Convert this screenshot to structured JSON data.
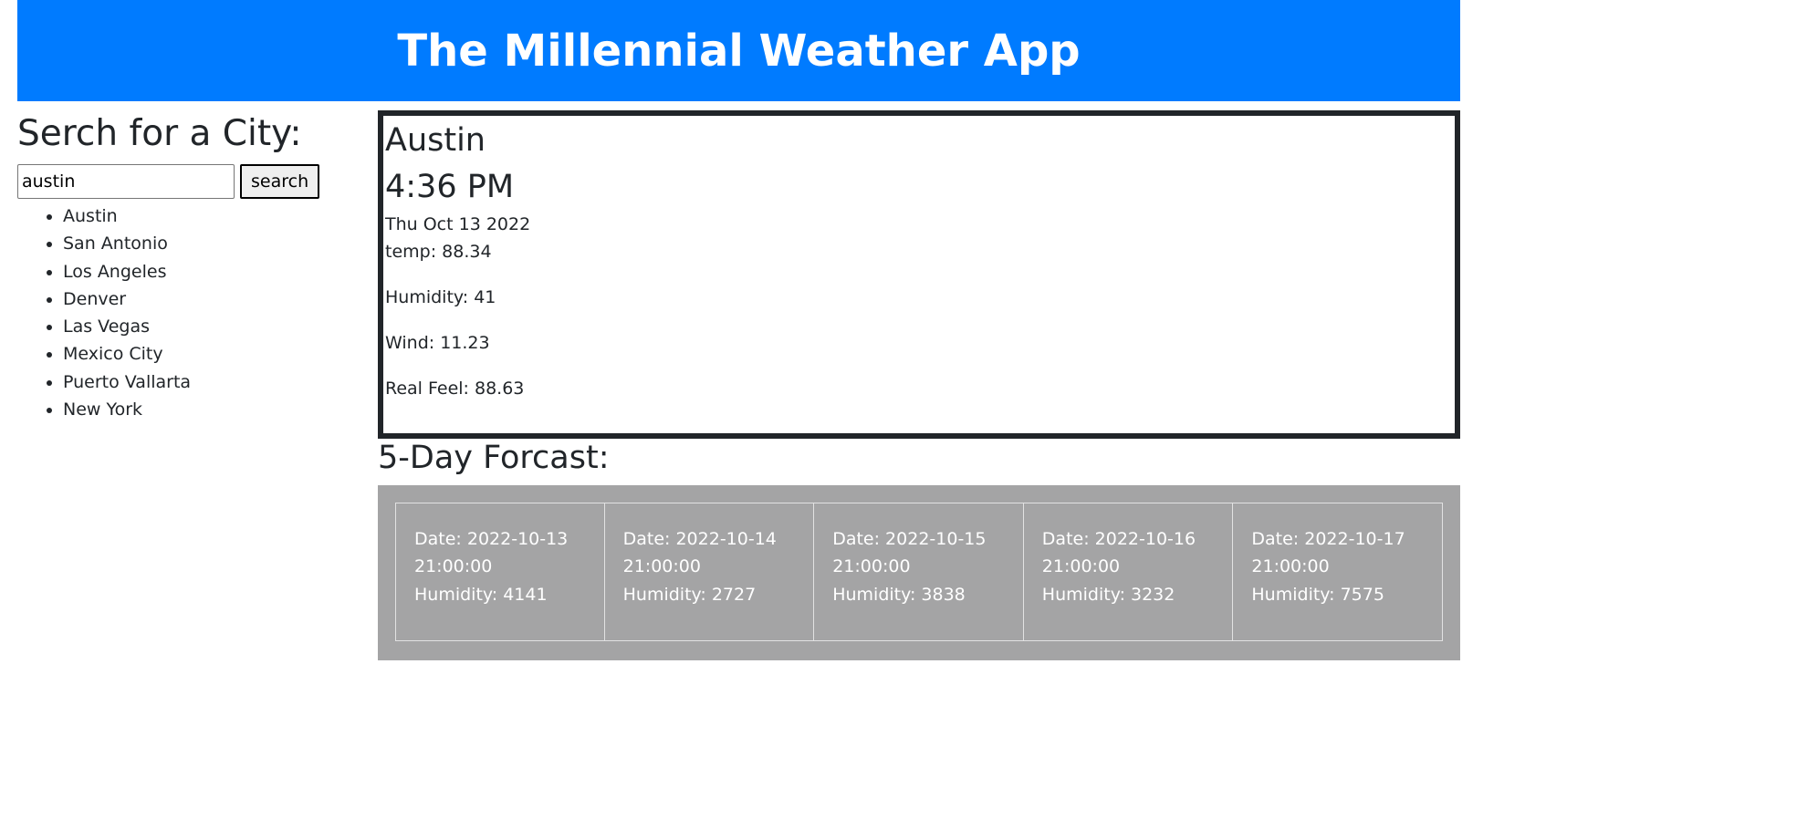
{
  "header": {
    "title": "The Millennial Weather App"
  },
  "sidebar": {
    "heading": "Serch for a City:",
    "search": {
      "value": "austin",
      "button_label": "search"
    },
    "cities": [
      "Austin",
      "San Antonio",
      "Los Angeles",
      "Denver",
      "Las Vegas",
      "Mexico City",
      "Puerto Vallarta",
      "New York"
    ]
  },
  "current": {
    "city": "Austin",
    "time": "4:36 PM",
    "date": "Thu Oct 13 2022",
    "temp": "temp: 88.34",
    "humidity": "Humidity: 41",
    "wind": "Wind: 11.23",
    "real_feel": "Real Feel: 88.63"
  },
  "forecast": {
    "title": "5-Day Forcast:",
    "days": [
      {
        "date": "Date: 2022-10-13",
        "time": "21:00:00",
        "humidity": "Humidity: 4141"
      },
      {
        "date": "Date: 2022-10-14",
        "time": "21:00:00",
        "humidity": "Humidity: 2727"
      },
      {
        "date": "Date: 2022-10-15",
        "time": "21:00:00",
        "humidity": "Humidity: 3838"
      },
      {
        "date": "Date: 2022-10-16",
        "time": "21:00:00",
        "humidity": "Humidity: 3232"
      },
      {
        "date": "Date: 2022-10-17",
        "time": "21:00:00",
        "humidity": "Humidity: 7575"
      }
    ]
  },
  "colors": {
    "header_bg": "#007bff",
    "forecast_bg": "#a4a4a5",
    "card_border": "#212529"
  }
}
